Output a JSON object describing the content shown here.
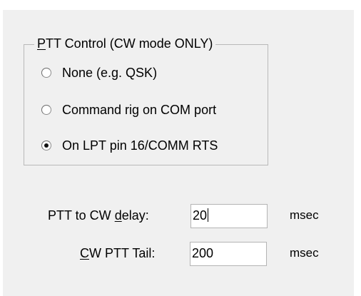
{
  "ptt_control": {
    "group_title_accel": "P",
    "group_title_rest": "TT Control (CW mode ONLY)",
    "options": [
      {
        "label": "None (e.g. QSK)",
        "checked": false
      },
      {
        "label": "Command rig on COM port",
        "checked": false
      },
      {
        "label": "On LPT pin 16/COMM RTS",
        "checked": true
      }
    ]
  },
  "delay": {
    "label_before": "PTT to CW ",
    "label_accel": "d",
    "label_after": "elay:",
    "value": "20",
    "unit": "msec"
  },
  "tail": {
    "label_accel": "C",
    "label_after": "W PTT Tail:",
    "value": "200",
    "unit": "msec"
  }
}
